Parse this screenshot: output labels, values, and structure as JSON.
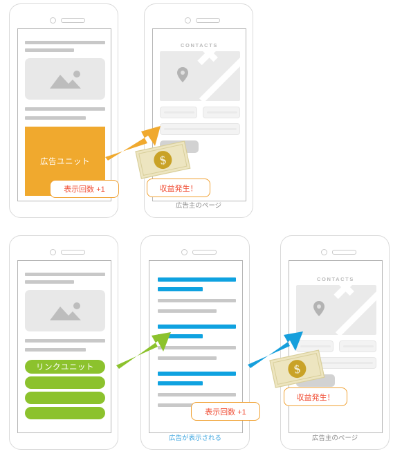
{
  "diagram": {
    "title": "Ad unit and link unit revenue flow",
    "colors": {
      "ad_unit_orange": "#F0A92E",
      "link_unit_green": "#8CC22D",
      "search_blue": "#0FA2E0",
      "badge_border": "#F0A030",
      "badge_text": "#F04B32",
      "money_bill": "#EDE5C0",
      "money_coin": "#C9A227",
      "placeholder_grey": "#c8c8c8"
    }
  },
  "rows": [
    {
      "id": "ad-unit-flow",
      "phones": [
        {
          "id": "publisher-ad-unit",
          "type": "article",
          "ad_unit_label": "広告ユニット",
          "badge": "表示回数 +1",
          "caption": ""
        },
        {
          "id": "advertiser-page-top",
          "type": "advertiser",
          "header": "CONTACTS",
          "badge": "収益発生！",
          "caption": "広告主のページ"
        }
      ],
      "arrows": [
        {
          "id": "orange-arrow",
          "color": "#F0A92E",
          "from": "publisher-ad-unit",
          "to": "advertiser-page-top"
        }
      ],
      "money": [
        {
          "id": "money-bill-top",
          "symbol": "$"
        }
      ]
    },
    {
      "id": "link-unit-flow",
      "phones": [
        {
          "id": "publisher-link-unit",
          "type": "article",
          "link_unit_label": "リンクユニット",
          "badge": "",
          "caption": ""
        },
        {
          "id": "search-results",
          "type": "search",
          "badge": "表示回数 +1",
          "caption": "広告が表示される"
        },
        {
          "id": "advertiser-page-bottom",
          "type": "advertiser",
          "header": "CONTACTS",
          "badge": "収益発生！",
          "caption": "広告主のページ"
        }
      ],
      "arrows": [
        {
          "id": "green-arrow",
          "color": "#8CC22D",
          "from": "publisher-link-unit",
          "to": "search-results"
        },
        {
          "id": "blue-arrow",
          "color": "#0FA2E0",
          "from": "search-results",
          "to": "advertiser-page-bottom"
        }
      ],
      "money": [
        {
          "id": "money-bill-bottom",
          "symbol": "$"
        }
      ]
    }
  ]
}
